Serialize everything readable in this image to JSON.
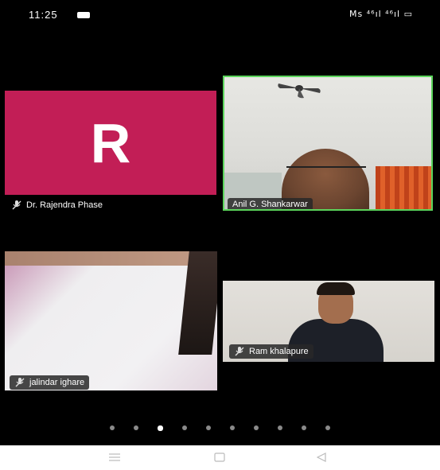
{
  "status": {
    "time": "11:25",
    "right_text": "Ms ⁴⁶ıl ⁴⁶ıl ▭"
  },
  "participants": [
    {
      "name": "Dr. Rajendra Phase",
      "avatar_letter": "R",
      "avatar_color": "#c21e56",
      "muted": true
    },
    {
      "name": "Anil G. Shankarwar",
      "active_speaker": true,
      "highlight_color": "#5bd45b"
    },
    {
      "name": "jalindar ighare",
      "muted": true
    },
    {
      "name": "Ram khalapure",
      "muted": true
    }
  ],
  "pager": {
    "count": 10,
    "active_index": 2
  },
  "nav": {
    "menu_icon": "menu-icon",
    "home_icon": "home-icon",
    "back_icon": "back-icon"
  }
}
